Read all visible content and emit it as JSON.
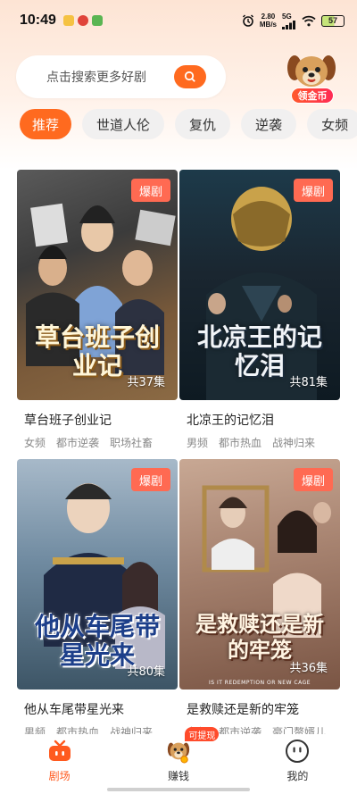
{
  "status_bar": {
    "time": "10:49",
    "net_speed_value": "2.80",
    "net_speed_unit": "MB/s",
    "signal_label": "5G",
    "battery": "57"
  },
  "search": {
    "placeholder": "点击搜索更多好剧"
  },
  "coin_widget": {
    "label": "领金币"
  },
  "tabs": [
    {
      "label": "推荐",
      "active": true
    },
    {
      "label": "世道人伦",
      "active": false
    },
    {
      "label": "复仇",
      "active": false
    },
    {
      "label": "逆袭",
      "active": false
    },
    {
      "label": "女频",
      "active": false
    }
  ],
  "dramas": [
    {
      "badge": "爆剧",
      "episodes": "共37集",
      "poster_text": "草台班子创业记",
      "title": "草台班子创业记",
      "tags": [
        "女频",
        "都市逆袭",
        "职场社畜"
      ]
    },
    {
      "badge": "爆剧",
      "episodes": "共81集",
      "poster_text": "北凉王的记忆泪",
      "title": "北凉王的记忆泪",
      "tags": [
        "男频",
        "都市热血",
        "战神归来"
      ]
    },
    {
      "badge": "爆剧",
      "episodes": "共80集",
      "poster_text": "他从车尾带星光来",
      "title": "他从车尾带星光来",
      "tags": [
        "男频",
        "都市热血",
        "战神归来"
      ]
    },
    {
      "badge": "爆剧",
      "episodes": "共36集",
      "poster_text": "是救赎还是新的牢笼",
      "poster_subtext": "IS IT REDEMPTION OR NEW CAGE",
      "title": "是救赎还是新的牢笼",
      "tags": [
        "女频",
        "都市逆袭",
        "豪门赘婿儿"
      ]
    }
  ],
  "bottom_nav": {
    "items": [
      {
        "label": "剧场",
        "icon": "tv-icon",
        "active": true
      },
      {
        "label": "赚钱",
        "icon": "dog-coin-icon",
        "active": false,
        "badge": "可提现"
      },
      {
        "label": "我的",
        "icon": "smiley-icon",
        "active": false
      }
    ]
  },
  "colors": {
    "accent": "#ff6a1f",
    "badge": "#ff6a52"
  }
}
